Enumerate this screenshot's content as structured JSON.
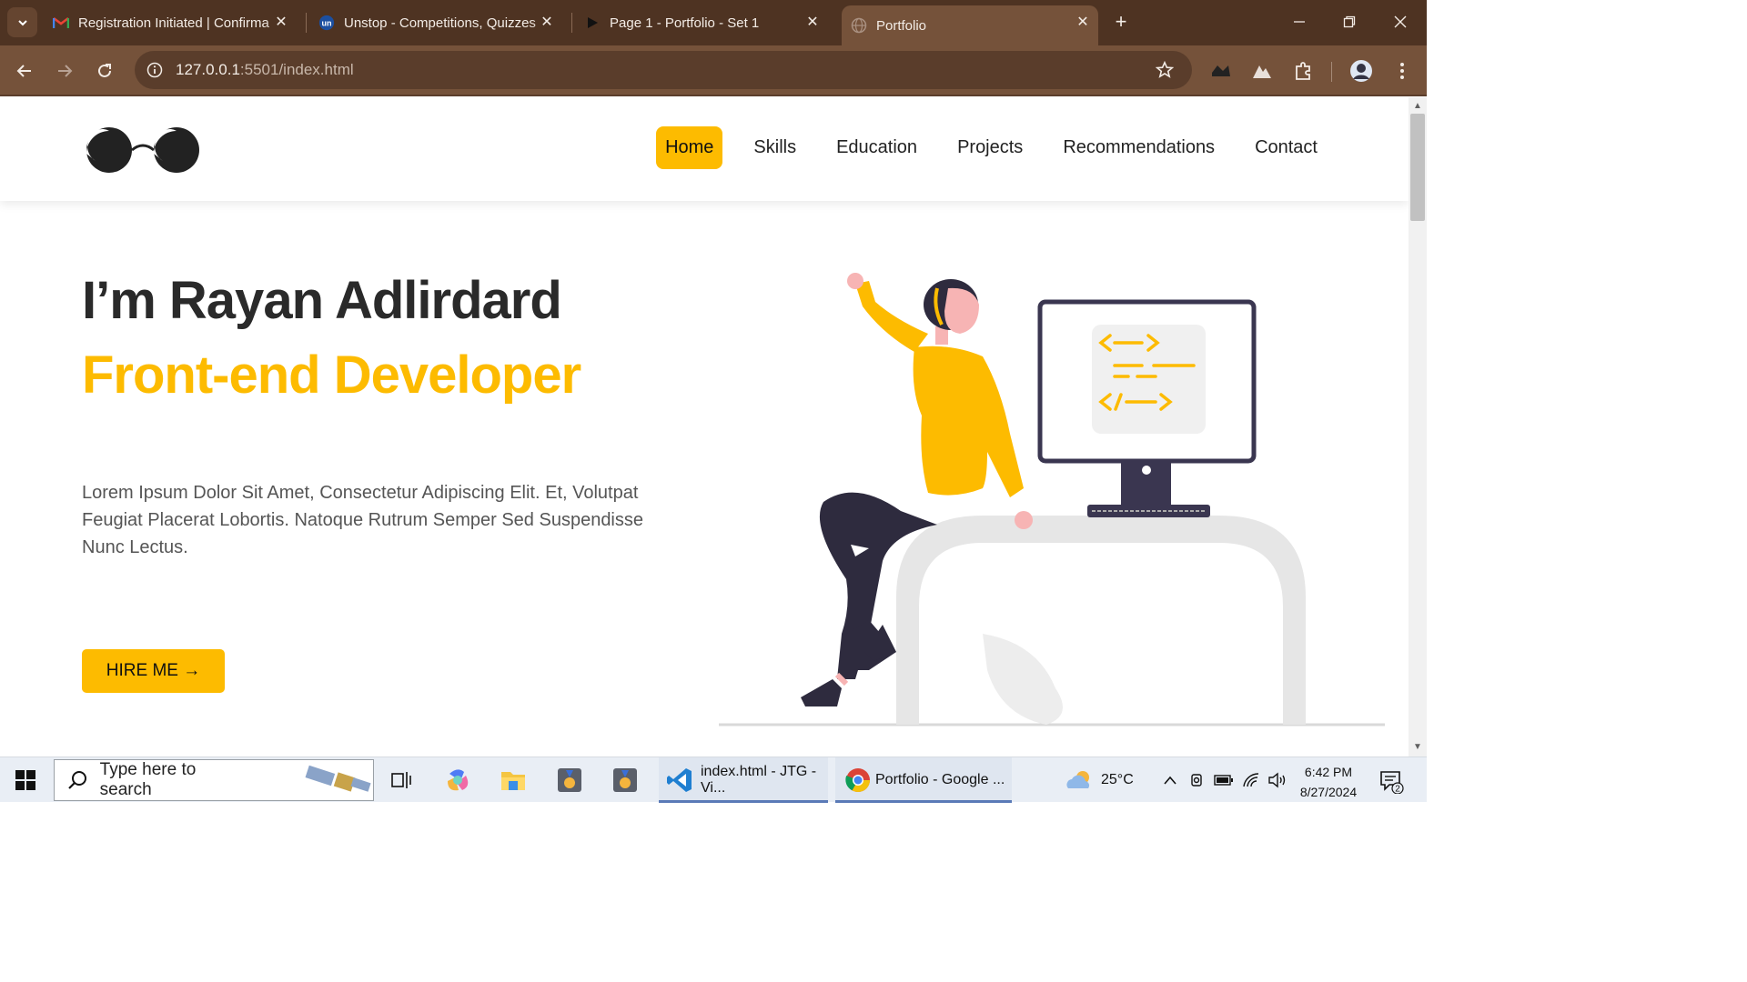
{
  "browser": {
    "tabs": [
      {
        "title": "Registration Initiated | Confirma",
        "icon": "gmail-icon"
      },
      {
        "title": "Unstop - Competitions, Quizzes",
        "icon": "unstop-icon"
      },
      {
        "title": "Page 1 - Portfolio - Set 1",
        "icon": "figma-play-icon"
      },
      {
        "title": "Portfolio",
        "icon": "globe-icon",
        "active": true
      }
    ],
    "url_host": "127.0.0.1",
    "url_path": ":5501/index.html"
  },
  "site": {
    "nav": [
      {
        "label": "Home",
        "active": true
      },
      {
        "label": "Skills"
      },
      {
        "label": "Education"
      },
      {
        "label": "Projects"
      },
      {
        "label": "Recommendations"
      },
      {
        "label": "Contact"
      }
    ],
    "hero": {
      "name": "I’m Rayan Adlirdard",
      "role": "Front-end Developer",
      "description": "Lorem Ipsum Dolor Sit Amet, Consectetur Adipiscing Elit. Et, Volutpat Feugiat Placerat Lobortis. Natoque Rutrum Semper Sed Suspendisse Nunc Lectus.",
      "cta": "HIRE ME →"
    },
    "colors": {
      "accent": "#fdbb00",
      "dark": "#2a2a2a"
    }
  },
  "taskbar": {
    "search_placeholder": "Type here to search",
    "apps": [
      {
        "label": "index.html - JTG - Vi...",
        "icon": "vscode-icon"
      },
      {
        "label": "Portfolio - Google ...",
        "icon": "chrome-icon"
      }
    ],
    "weather": "25°C",
    "time": "6:42 PM",
    "date": "8/27/2024",
    "notifications": "2"
  }
}
